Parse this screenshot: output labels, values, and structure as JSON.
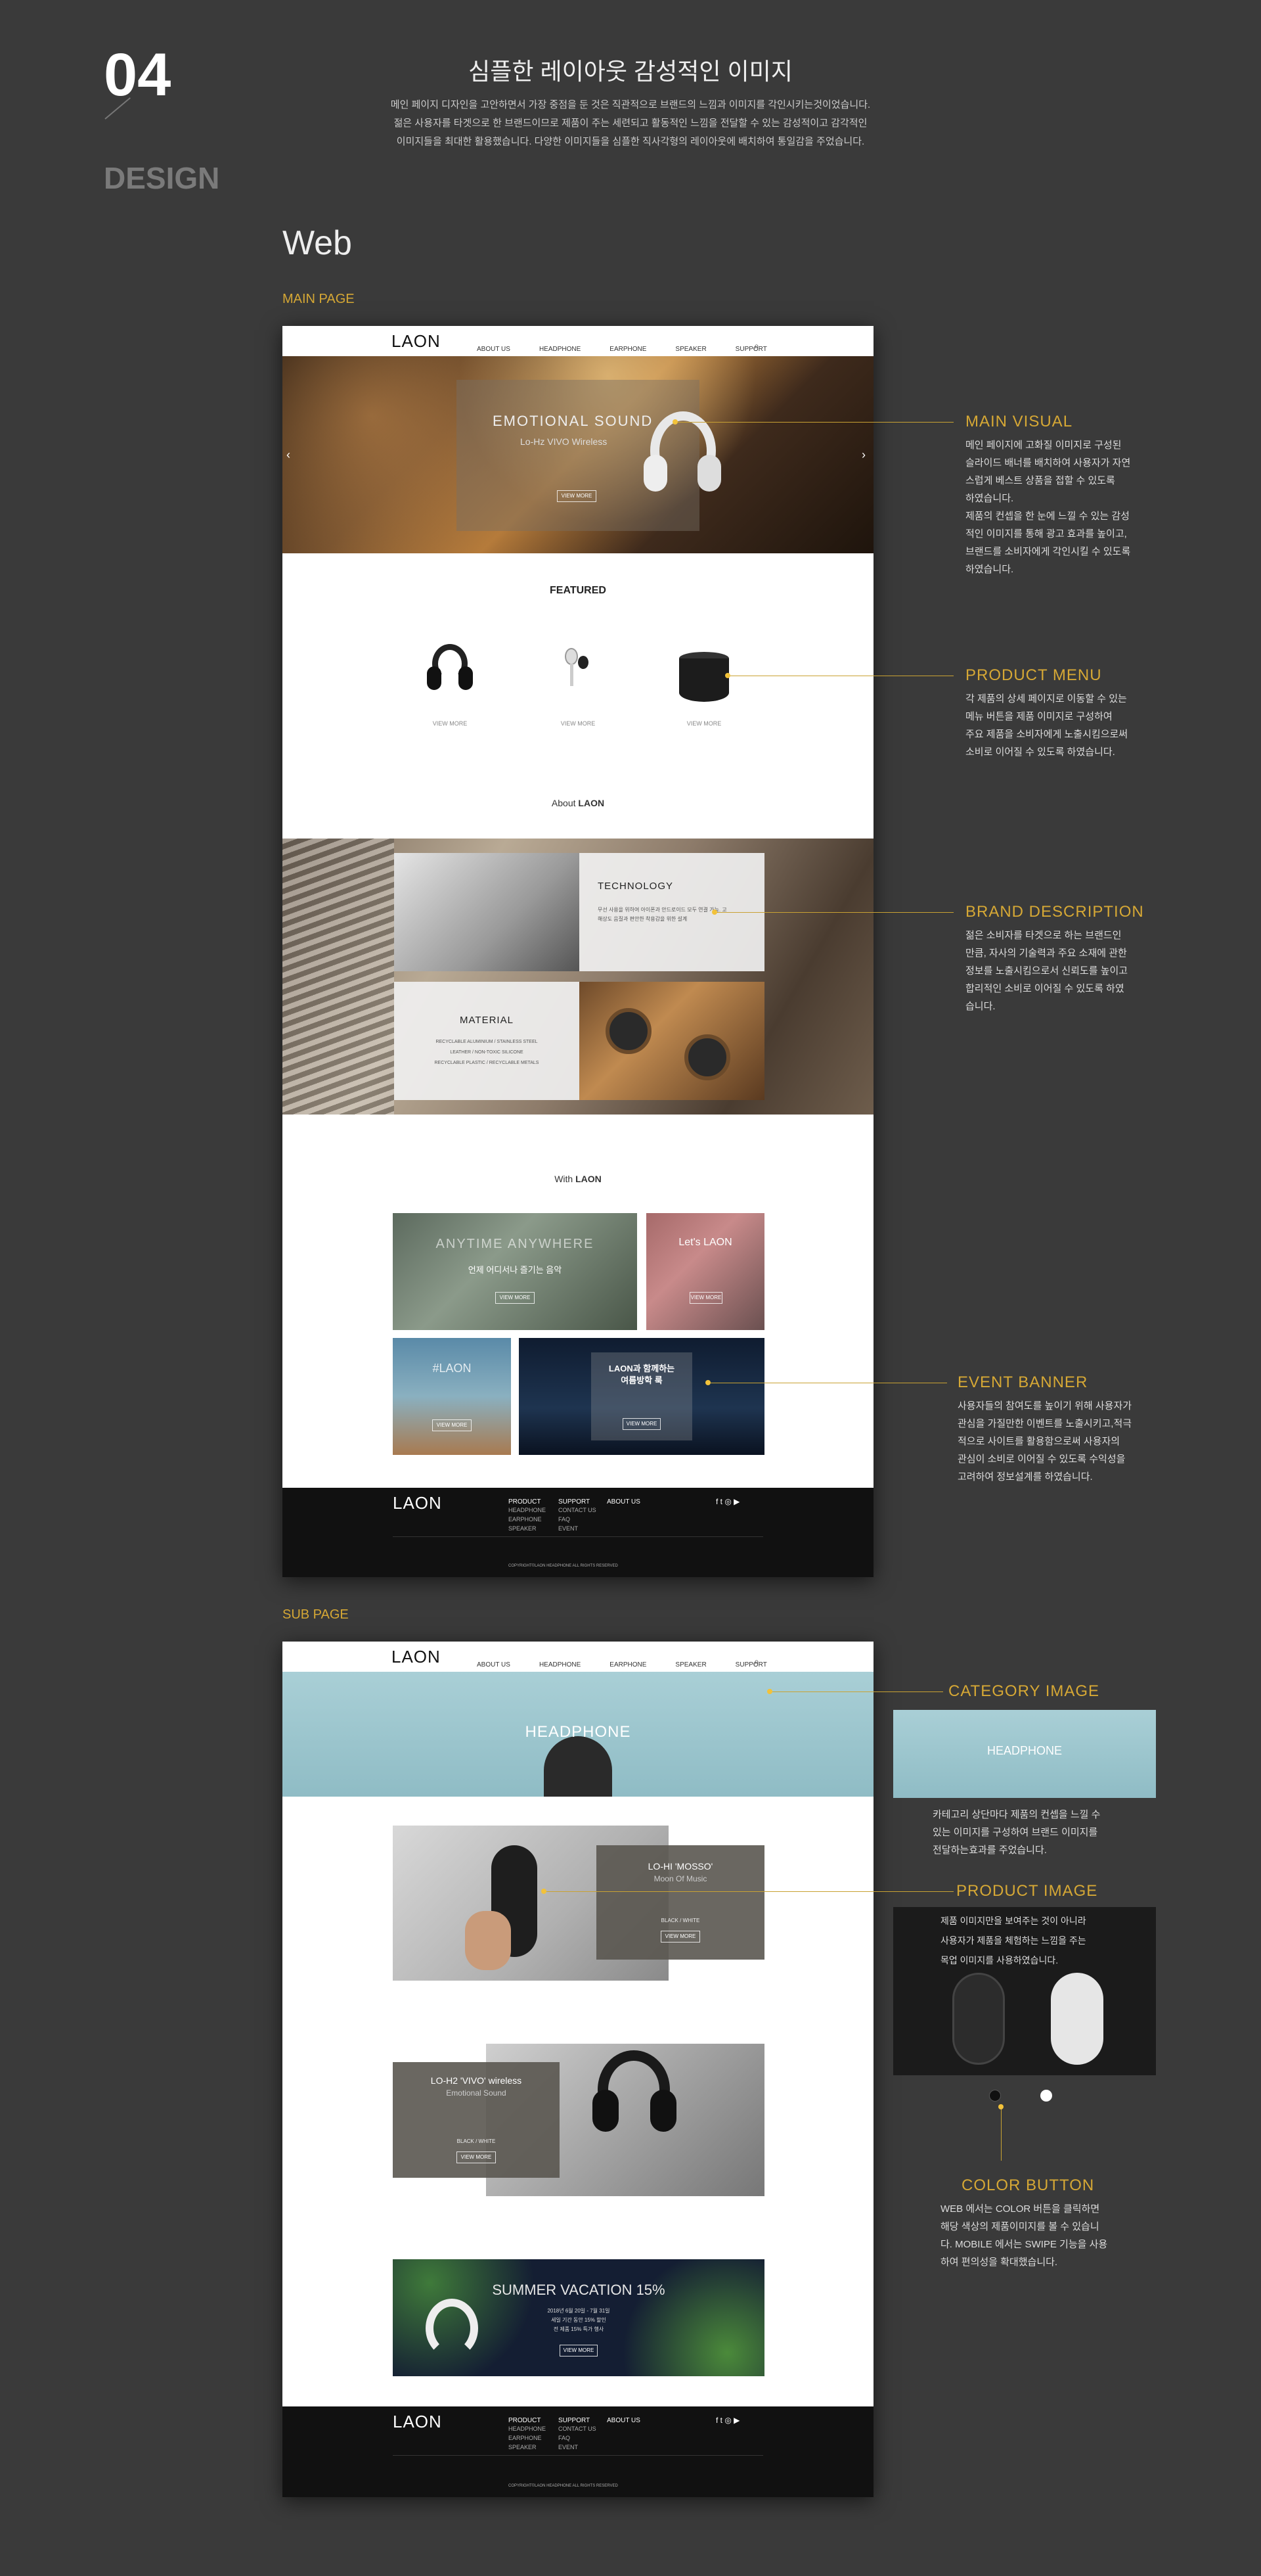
{
  "header": {
    "number": "04",
    "design_label": "DESIGN",
    "title": "심플한 레이아웃 감성적인 이미지",
    "desc_line1": "메인 페이지 디자인을 고안하면서 가장 중점을 둔 것은 직관적으로 브랜드의 느낌과 이미지를 각인시키는것이었습니다.",
    "desc_line2": "젊은 사용자를 타겟으로 한 브랜드이므로 제품이 주는 세련되고 활동적인 느낌을 전달할 수 있는 감성적이고 감각적인",
    "desc_line3": "이미지들을 최대한 활용했습니다. 다양한 이미지들을 심플한 직사각형의 레이아웃에 배치하여 통일감을 주었습니다."
  },
  "web_title": "Web",
  "main_page_label": "MAIN PAGE",
  "sub_page_label": "SUB PAGE",
  "site": {
    "logo": "LAON",
    "nav": [
      "ABOUT US",
      "HEADPHONE",
      "EARPHONE",
      "SPEAKER",
      "SUPPORT"
    ],
    "hero_title": "EMOTIONAL SOUND",
    "hero_sub": "Lo-Hz VIVO   Wireless",
    "view_more": "VIEW MORE",
    "featured": "FEATURED",
    "featured_items": [
      "VIEW MORE",
      "VIEW MORE",
      "VIEW MORE"
    ],
    "about_prefix": "About ",
    "about_brand": "LAON",
    "technology": "TECHNOLOGY",
    "technology_text": "무선 사용을 위하여 아이폰과 안드로이드 모두 연결 가능. 고해상도 음질과 편안한 착용감을 위한 설계",
    "material": "MATERIAL",
    "material_lines": [
      "RECYCLABLE ALUMINIUM / STAINLESS STEEL",
      "LEATHER / NON-TOXIC SILICONE",
      "RECYCLABLE PLASTIC / RECYCLABLE METALS"
    ],
    "with_prefix": "With ",
    "with_brand": "LAON",
    "ev1_title": "ANYTIME ANYWHERE",
    "ev1_sub": "언제 어디서나 즐기는 음악",
    "ev2_title": "Let's LAON",
    "ev3_title": "#LAON",
    "ev4_title": "LAON과 함께하는",
    "ev4_title2": "여름방학 룩",
    "footer_cols": [
      {
        "head": "PRODUCT",
        "items": [
          "HEADPHONE",
          "EARPHONE",
          "SPEAKER"
        ]
      },
      {
        "head": "SUPPORT",
        "items": [
          "CONTACT US",
          "FAQ",
          "EVENT"
        ]
      },
      {
        "head": "ABOUT US",
        "items": []
      }
    ],
    "social": "f  t  ◎  ▶",
    "copyright": "COPYRIGHT©LAON HEADPHONE ALL RIGHTS RESERVED"
  },
  "sub": {
    "category_title": "HEADPHONE",
    "p1_title": "LO-HI 'MOSSO'",
    "p1_sub": "Moon Of Music",
    "p1_colors": "BLACK / WHITE",
    "p2_title": "LO-H2 'VIVO' wireless",
    "p2_sub": "Emotional Sound",
    "p2_colors": "BLACK / WHITE",
    "banner_title": "SUMMER VACATION 15%",
    "banner_line1": "2018년 6월 20일 - 7월 31일",
    "banner_line2": "세일 기간 동안 15% 할인",
    "banner_line3": "전 제품 15% 특가 행사"
  },
  "annotations": {
    "main_visual": {
      "title": "MAIN VISUAL",
      "lines": [
        "메인 페이지에 고화질 이미지로 구성된",
        "슬라이드 배너를 배치하여 사용자가 자연",
        "스럽게 베스트 상품을 접할 수 있도록",
        "하였습니다.",
        "제품의 컨셉을 한 눈에 느낄 수 있는 감성",
        "적인 이미지를 통해 광고 효과를 높이고,",
        "브랜드를 소비자에게 각인시킬 수 있도록",
        "하였습니다."
      ]
    },
    "product_menu": {
      "title": "PRODUCT MENU",
      "lines": [
        "각 제품의 상세 페이지로 이동할 수 있는",
        "메뉴 버튼을  제품 이미지로 구성하여",
        "주요 제품을 소비자에게 노출시킴으로써",
        "소비로 이어질 수 있도록 하였습니다."
      ]
    },
    "brand_description": {
      "title": "BRAND DESCRIPTION",
      "lines": [
        "젊은 소비자를 타겟으로 하는 브랜드인",
        "만큼, 자사의 기술력과 주요 소재에 관한",
        "정보를 노출시킴으로서 신뢰도를 높이고",
        "합리적인 소비로 이어질 수 있도록 하였",
        "습니다."
      ]
    },
    "event_banner": {
      "title": "EVENT BANNER",
      "lines": [
        "사용자들의 참여도를 높이기 위해 사용자가",
        "관심을 가질만한 이벤트를 노출시키고,적극",
        "적으로 사이트를 활용함으로써 사용자의",
        "관심이 소비로 이어질 수 있도록 수익성을",
        "고려하여 정보설계를 하였습니다."
      ]
    },
    "category_image": {
      "title": "CATEGORY IMAGE",
      "lines": [
        "카테고리 상단마다 제품의 컨셉을 느낄 수",
        "있는 이미지를 구성하여 브랜드 이미지를",
        "전달하는효과를 주었습니다."
      ]
    },
    "product_image": {
      "title": "PRODUCT IMAGE",
      "lines": [
        "제품 이미지만을 보여주는 것이 아니라",
        "사용자가 제품을 체험하는 느낌을 주는",
        "목업 이미지를 사용하였습니다."
      ]
    },
    "color_button": {
      "title": "COLOR BUTTON",
      "lines": [
        "WEB 에서는 COLOR 버튼을 클릭하면",
        "해당 색상의 제품이미지를 볼 수 있습니",
        "다. MOBILE 에서는 SWIPE 기능을 사용",
        "하여 편의성을 확대했습니다."
      ]
    }
  },
  "colors": {
    "accent": "#d6a835",
    "background": "#3a3a3a"
  }
}
